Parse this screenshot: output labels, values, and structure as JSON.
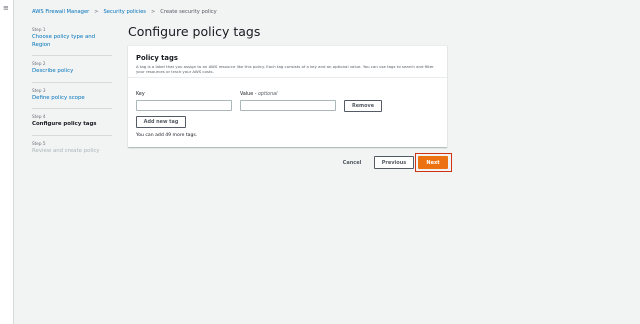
{
  "nav": {
    "menu_icon": "hamburger-icon",
    "menu_glyph": "≡"
  },
  "breadcrumb": {
    "items": [
      "AWS Firewall Manager",
      "Security policies",
      "Create security policy"
    ],
    "separator": ">"
  },
  "steps": [
    {
      "number": "Step 1",
      "title": "Choose policy type and Region",
      "state": "link"
    },
    {
      "number": "Step 2",
      "title": "Describe policy",
      "state": "link"
    },
    {
      "number": "Step 3",
      "title": "Define policy scope",
      "state": "link"
    },
    {
      "number": "Step 4",
      "title": "Configure policy tags",
      "state": "current"
    },
    {
      "number": "Step 5",
      "title": "Review and create policy",
      "state": "disabled"
    }
  ],
  "page": {
    "title": "Configure policy tags"
  },
  "panel": {
    "title": "Policy tags",
    "description": "A tag is a label that you assign to an AWS resource like this policy. Each tag consists of a key and an optional value. You can use tags to search and filter your resources or track your AWS costs.",
    "key_label": "Key",
    "value_label": "Value",
    "value_optional": "- optional",
    "key_value": "",
    "value_value": "",
    "remove_label": "Remove",
    "add_tag_label": "Add new tag",
    "remaining_hint": "You can add 49 more tags."
  },
  "footer": {
    "cancel_label": "Cancel",
    "previous_label": "Previous",
    "next_label": "Next"
  },
  "colors": {
    "link": "#0073bb",
    "primary": "#ec7211",
    "highlight": "#d13212",
    "background": "#f2f3f3"
  }
}
